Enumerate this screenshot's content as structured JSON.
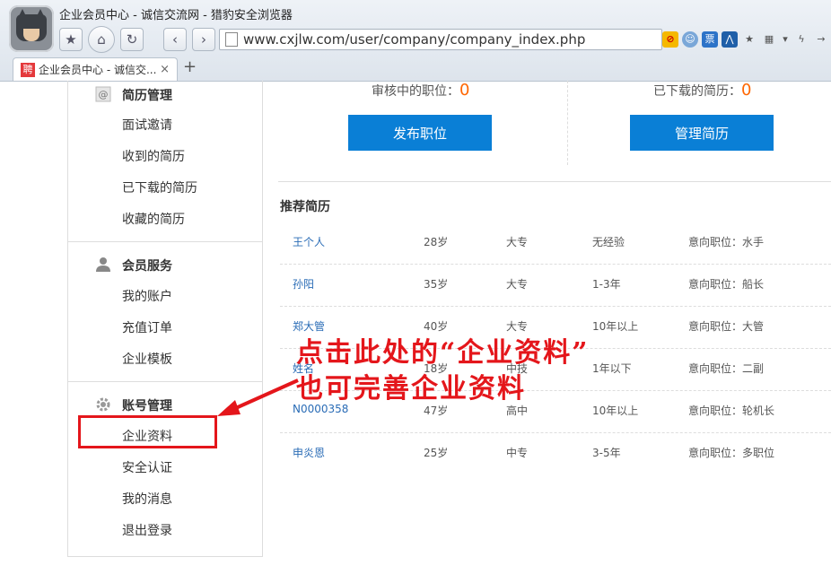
{
  "window": {
    "title": "企业会员中心 - 诚信交流网 - 猎豹安全浏览器"
  },
  "address": {
    "url": "www.cxjlw.com/user/company/company_index.php"
  },
  "tab": {
    "favicon": "聘",
    "label": "企业会员中心 - 诚信交...",
    "close": "×",
    "new": "+"
  },
  "toolbar": {
    "favorite": "★",
    "home": "⌂",
    "refresh": "↻",
    "back": "‹",
    "forward": "›",
    "ticket": "票"
  },
  "sidebar": {
    "resume": {
      "title": "简历管理",
      "items": [
        "面试邀请",
        "收到的简历",
        "已下载的简历",
        "收藏的简历"
      ]
    },
    "member": {
      "title": "会员服务",
      "items": [
        "我的账户",
        "充值订单",
        "企业模板"
      ]
    },
    "account": {
      "title": "账号管理",
      "items": [
        "企业资料",
        "安全认证",
        "我的消息",
        "退出登录"
      ]
    }
  },
  "main": {
    "pending_label": "审核中的职位：",
    "pending_value": "0",
    "downloaded_label": "已下载的简历：",
    "downloaded_value": "0",
    "publish_button": "发布职位",
    "manage_button": "管理简历",
    "recommend_title": "推荐简历",
    "resumes": [
      {
        "name": "王个人",
        "age": "28岁",
        "edu": "大专",
        "exp": "无经验",
        "job": "意向职位：水手"
      },
      {
        "name": "孙阳",
        "age": "35岁",
        "edu": "大专",
        "exp": "1-3年",
        "job": "意向职位：船长"
      },
      {
        "name": "郑大管",
        "age": "40岁",
        "edu": "大专",
        "exp": "10年以上",
        "job": "意向职位：大管"
      },
      {
        "name": "姓名",
        "age": "18岁",
        "edu": "中技",
        "exp": "1年以下",
        "job": "意向职位：二副"
      },
      {
        "name": "N0000358",
        "age": "47岁",
        "edu": "高中",
        "exp": "10年以上",
        "job": "意向职位：轮机长"
      },
      {
        "name": "申炎恩",
        "age": "25岁",
        "edu": "中专",
        "exp": "3-5年",
        "job": "意向职位：多职位"
      }
    ]
  },
  "annotation": {
    "line1": "点击此处的“企业资料”",
    "line2": "也可完善企业资料",
    "color": "#e4161b"
  }
}
